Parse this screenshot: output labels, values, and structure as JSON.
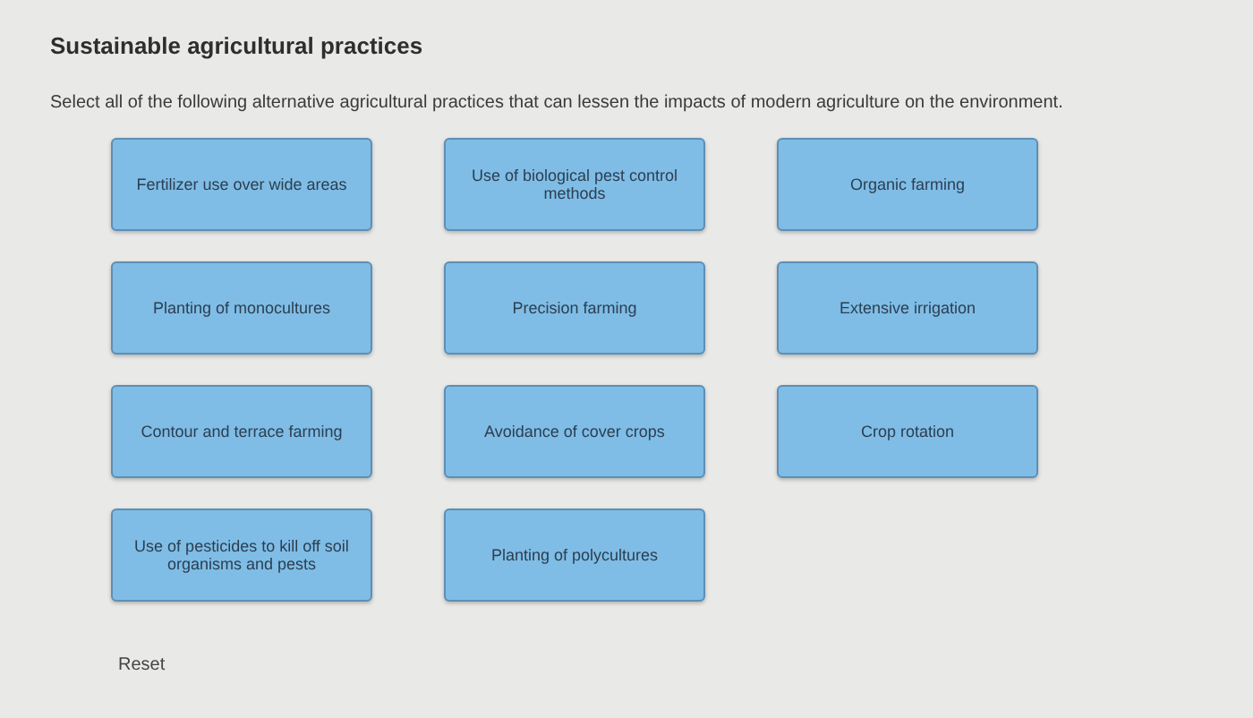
{
  "title": "Sustainable agricultural practices",
  "instruction": "Select all of the following alternative agricultural practices that can lessen the impacts of modern agriculture on the environment.",
  "options": [
    {
      "label": "Fertilizer use over wide areas"
    },
    {
      "label": "Use of biological pest control methods"
    },
    {
      "label": "Organic farming"
    },
    {
      "label": "Planting of monocultures"
    },
    {
      "label": "Precision farming"
    },
    {
      "label": "Extensive irrigation"
    },
    {
      "label": "Contour and terrace farming"
    },
    {
      "label": "Avoidance of cover crops"
    },
    {
      "label": "Crop rotation"
    },
    {
      "label": "Use of pesticides to kill off soil organisms and pests"
    },
    {
      "label": "Planting of polycultures"
    }
  ],
  "reset_button": "Reset"
}
